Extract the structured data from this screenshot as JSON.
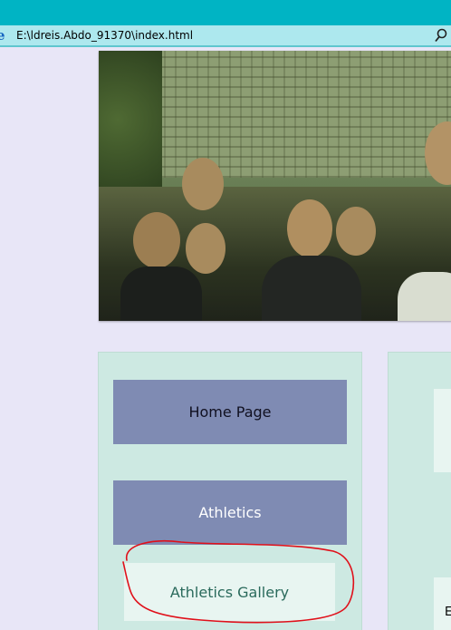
{
  "browser": {
    "address_url": "E:\\ldreis.Abdo_91370\\index.html",
    "icons": [
      "ie-page-icon",
      "search-icon"
    ]
  },
  "hero": {
    "image_icon": "group-photo"
  },
  "nav": {
    "items": [
      {
        "label": "Home Page"
      },
      {
        "label": "Athletics"
      },
      {
        "label": "Athletics Gallery"
      }
    ]
  },
  "right_panel": {
    "partial_text": "E"
  },
  "colors": {
    "title_strip": "#00b4c4",
    "address_bar": "#ade8ee",
    "page_bg": "#e8e6f7",
    "panel_bg": "#cde9e2",
    "nav_button": "#7f8bb3",
    "gallery_button": "#e8f5f1",
    "annotation": "#e0101a"
  }
}
